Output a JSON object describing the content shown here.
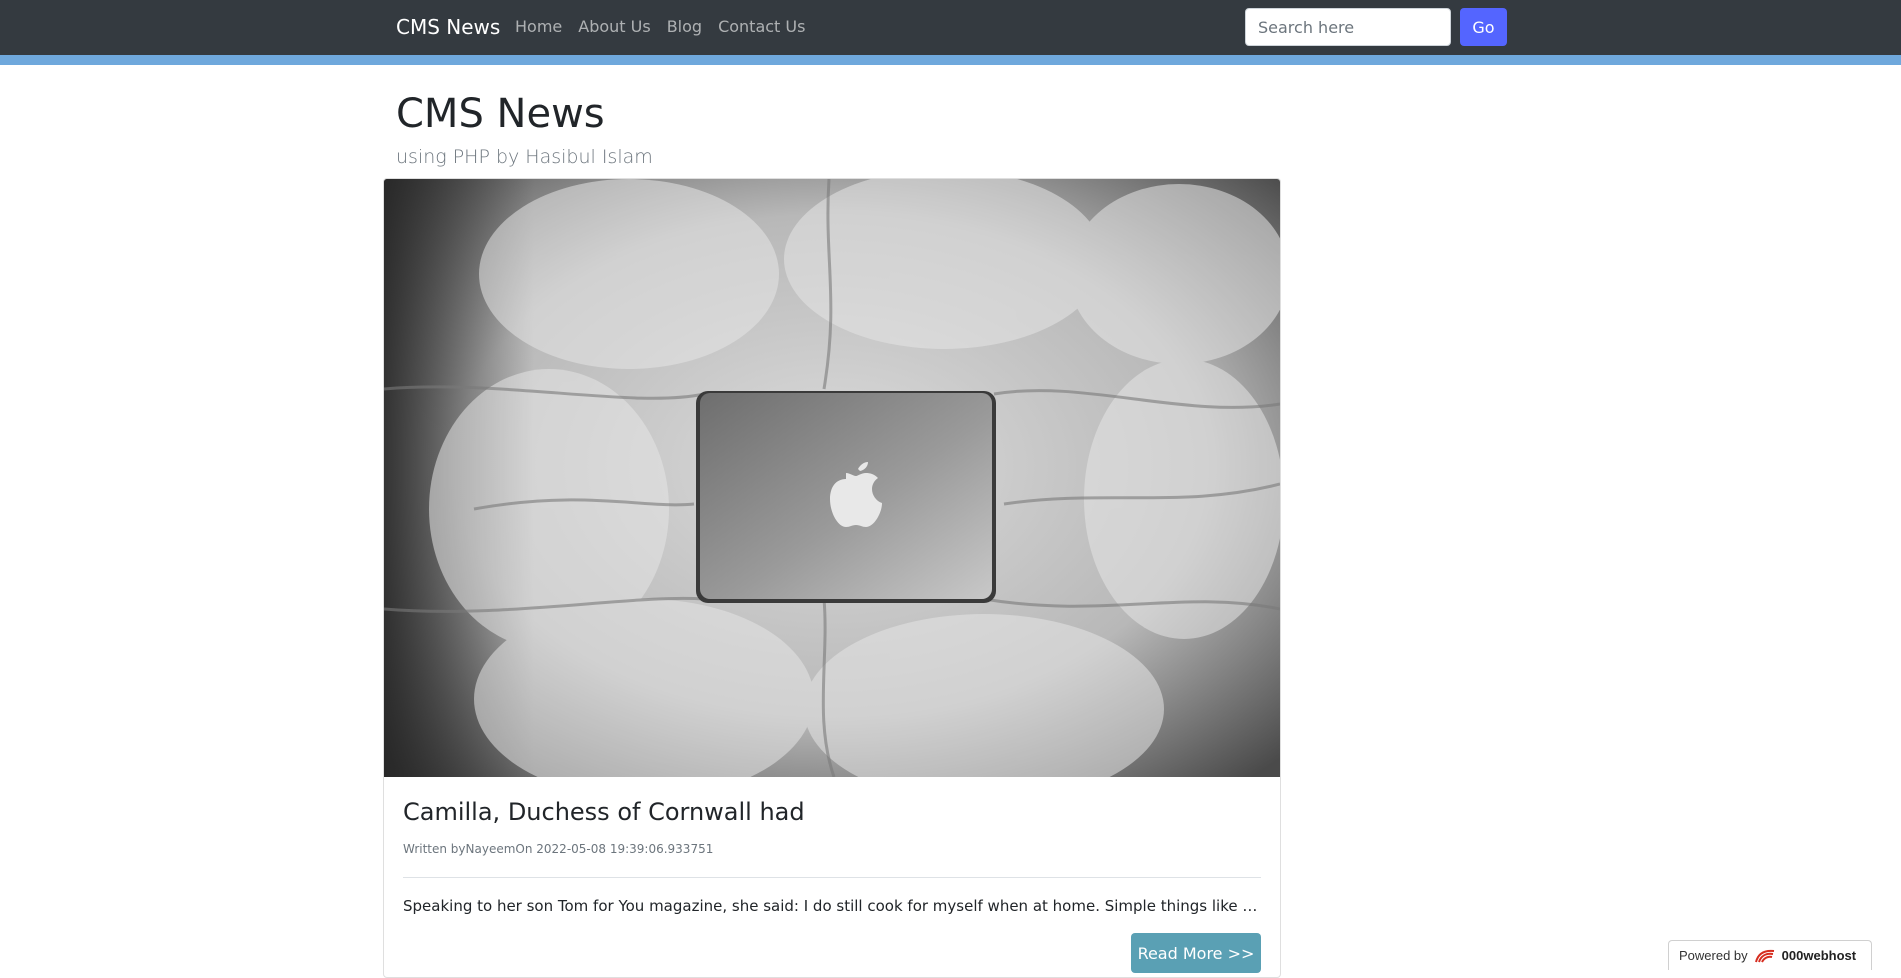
{
  "navbar": {
    "brand": "CMS News",
    "links": [
      "Home",
      "About Us",
      "Blog",
      "Contact Us"
    ],
    "search_placeholder": "Search here",
    "search_value": "",
    "go_label": "Go"
  },
  "header": {
    "title": "CMS News",
    "subtitle": "using PHP by Hasibul Islam"
  },
  "post": {
    "image_icon": "laptop-on-bedding-photo",
    "title": "Camilla, Duchess of Cornwall had",
    "meta": "Written byNayeemOn 2022-05-08 19:39:06.933751",
    "excerpt": "Speaking to her son Tom for You magazine, she said: I do still cook for myself when at home. Simple things like fish en p...",
    "read_more_label": "Read More >>"
  },
  "badge": {
    "powered_label": "Powered by",
    "host_name": "000webhost",
    "logo_icon": "000webhost-logo-icon"
  },
  "colors": {
    "navbar_bg": "#343a40",
    "navbar_stripe": "#6fa8dc",
    "go_button": "#5465ff",
    "read_more_button": "#5aa0b4"
  }
}
